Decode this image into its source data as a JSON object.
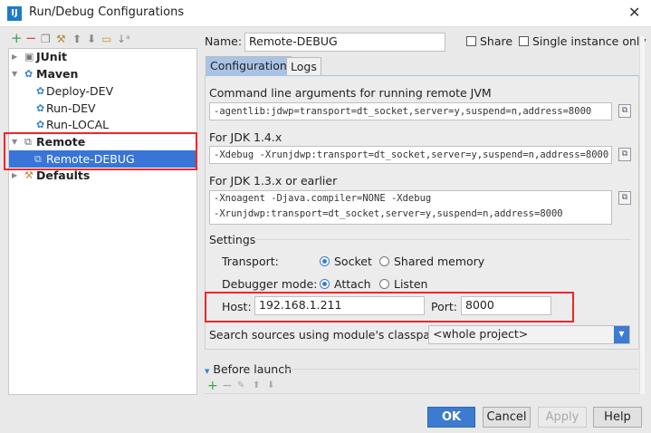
{
  "window": {
    "title": "Run/Debug Configurations",
    "logo": "IJ"
  },
  "left_toolbar": [
    "add-icon",
    "remove-icon",
    "copy-icon",
    "wrench-icon",
    "move-up-icon",
    "move-down-icon",
    "folder-icon",
    "sort-icon"
  ],
  "tree": {
    "junit": "JUnit",
    "maven": "Maven",
    "deploy_dev": "Deploy-DEV",
    "run_dev": "Run-DEV",
    "run_local": "Run-LOCAL",
    "remote": "Remote",
    "remote_debug": "Remote-DEBUG",
    "defaults": "Defaults"
  },
  "name": {
    "label": "Name:",
    "value": "Remote-DEBUG"
  },
  "share": {
    "label": "Share",
    "checked": false
  },
  "single_instance": {
    "label": "Single instance only",
    "checked": false
  },
  "tabs": [
    "Configuration",
    "Logs"
  ],
  "config": {
    "cmd_label": "Command line arguments for running remote JVM",
    "cmd_value": "-agentlib:jdwp=transport=dt_socket,server=y,suspend=n,address=8000",
    "jdk14_label": "For JDK 1.4.x",
    "jdk14_value": "-Xdebug -Xrunjdwp:transport=dt_socket,server=y,suspend=n,address=8000",
    "jdk13_label": "For JDK 1.3.x or earlier",
    "jdk13_line1": "-Xnoagent -Djava.compiler=NONE -Xdebug",
    "jdk13_line2": "-Xrunjdwp:transport=dt_socket,server=y,suspend=n,address=8000"
  },
  "settings": {
    "title": "Settings",
    "transport_label": "Transport:",
    "socket": "Socket",
    "shared_memory": "Shared memory",
    "transport_selected": "Socket",
    "mode_label": "Debugger mode:",
    "attach": "Attach",
    "listen": "Listen",
    "mode_selected": "Attach",
    "host_label": "Host:",
    "host": "192.168.1.211",
    "port_label": "Port:",
    "port": "8000",
    "classpath_label": "Search sources using module's classpath:",
    "classpath_value": "<whole project>"
  },
  "before_launch": {
    "label": "Before launch"
  },
  "buttons": {
    "ok": "OK",
    "cancel": "Cancel",
    "apply": "Apply",
    "help": "Help"
  },
  "colors": {
    "selection": "#3875d7",
    "highlight": "#f0262a",
    "ok": "#3c7bd0"
  }
}
